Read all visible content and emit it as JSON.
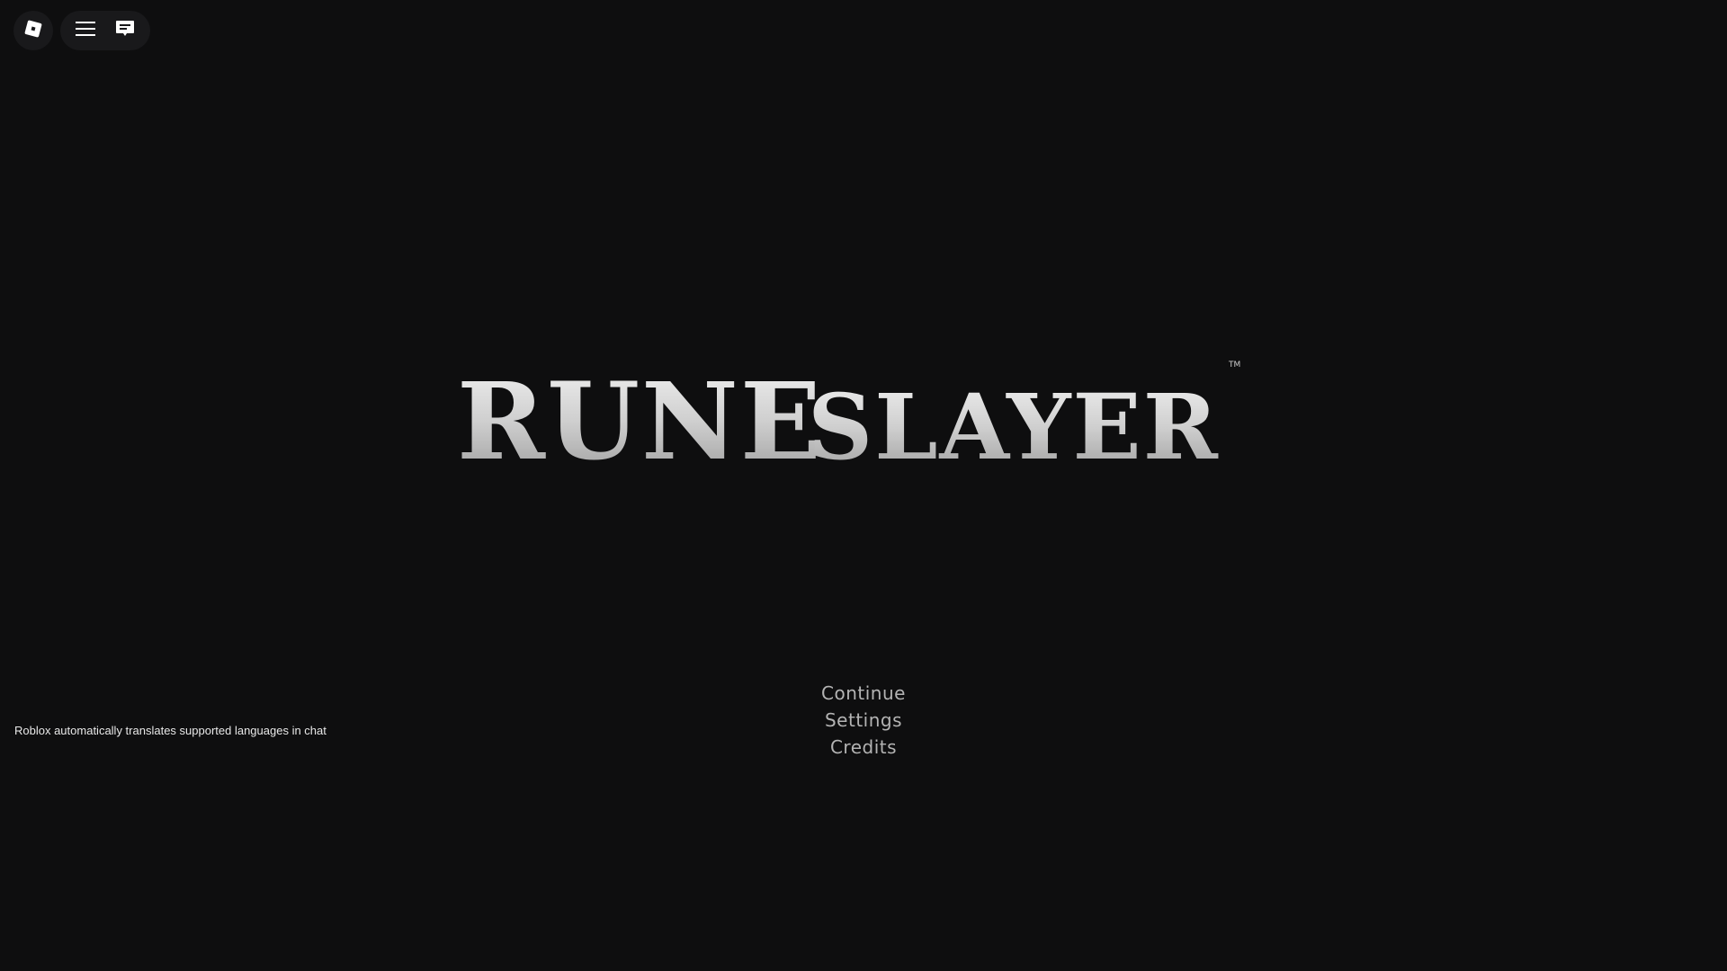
{
  "topbar": {
    "roblox_menu_icon": "roblox-logo-icon",
    "hamburger_icon": "hamburger-icon",
    "chat_icon": "chat-icon"
  },
  "logo": {
    "text_first": "RUNE",
    "text_second": "SLAYER",
    "trademark": "TM"
  },
  "menu": {
    "items": [
      "Continue",
      "Settings",
      "Credits"
    ]
  },
  "chat": {
    "notice": "Roblox automatically translates supported languages in chat"
  },
  "colors": {
    "background": "#0e0e0f",
    "menu_text": "#b3b3b3",
    "logo_silver": "#d9d9d9"
  }
}
